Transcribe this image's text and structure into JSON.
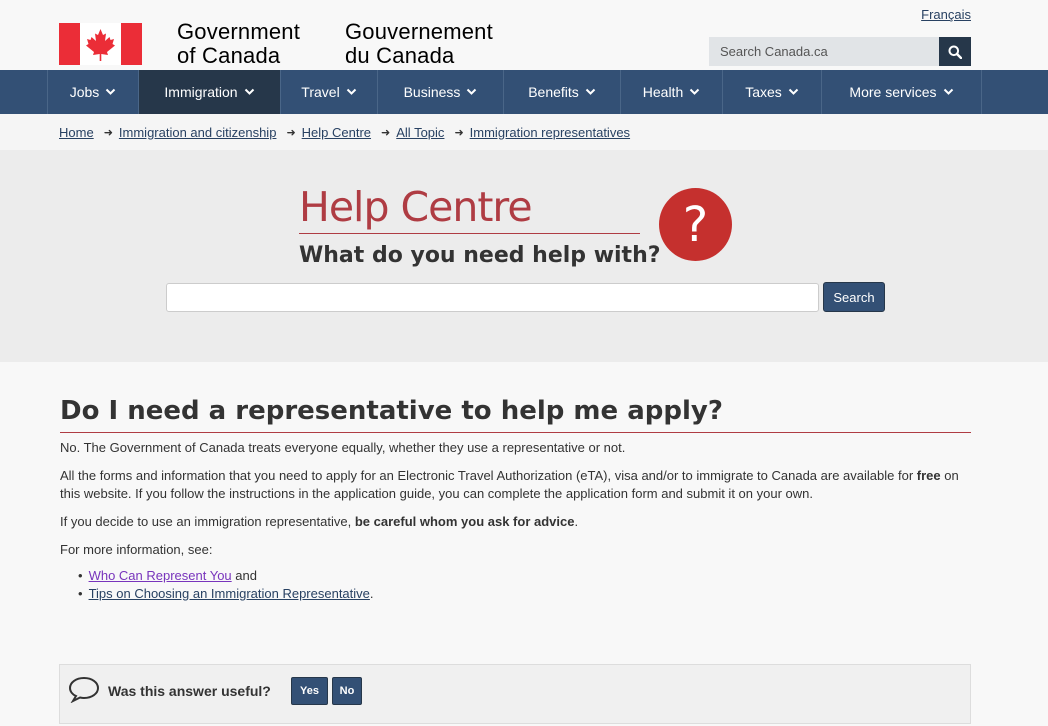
{
  "header": {
    "signature_en_line1": "Government",
    "signature_en_line2": "of Canada",
    "signature_fr_line1": "Gouvernement",
    "signature_fr_line2": "du Canada",
    "language_link": "Français",
    "search_placeholder": "Search Canada.ca",
    "flag_color": "#eb2d37"
  },
  "menu": {
    "items": [
      {
        "label": "Jobs"
      },
      {
        "label": "Immigration"
      },
      {
        "label": "Travel"
      },
      {
        "label": "Business"
      },
      {
        "label": "Benefits"
      },
      {
        "label": "Health"
      },
      {
        "label": "Taxes"
      },
      {
        "label": "More services"
      }
    ],
    "active": "Immigration"
  },
  "breadcrumb": {
    "items": [
      "Home",
      "Immigration and citizenship",
      "Help Centre",
      "All Topic",
      "Immigration representatives"
    ]
  },
  "banner": {
    "title": "Help Centre",
    "subtitle": "What do you need help with?",
    "question_mark": "?",
    "search_button": "Search",
    "accent": "#af3c43"
  },
  "main": {
    "title": "Do I need a representative to help me apply?",
    "p1": "No. The Government of Canada treats everyone equally, whether they use a representative or not.",
    "p2_part1": "All the forms and information that you need to apply for an Electronic Travel Authorization (eTA), visa and/or to immigrate to Canada are available for ",
    "p2_bold": "free",
    "p2_part2": " on this website. If you follow the instructions in the application guide, you can complete the application form and submit it on your own.",
    "p3_part1": "If you decide to use an immigration representative, ",
    "p3_bold": "be careful whom you ask for advice",
    "p3_part2": ".",
    "p4": "For more information, see:",
    "link1": "Who Can Represent You",
    "link1_suffix": " and",
    "link2": "Tips on Choosing an Immigration Representative",
    "link2_suffix": "."
  },
  "feedback": {
    "question": "Was this answer useful?",
    "yes": "Yes",
    "no": "No"
  }
}
